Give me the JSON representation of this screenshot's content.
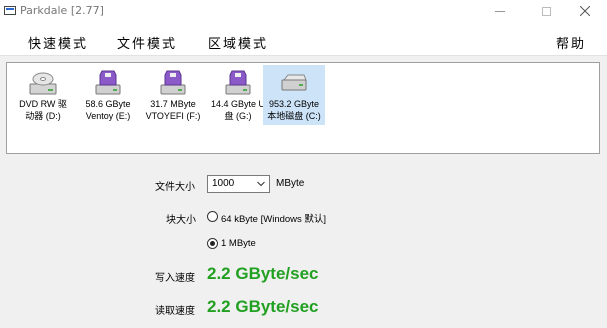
{
  "window": {
    "title": "Parkdale [2.77]",
    "controls": {
      "minimize": "minimize-icon",
      "maximize": "maximize-icon",
      "close": "close-icon"
    }
  },
  "menu": {
    "quick_mode": "快速模式",
    "file_mode": "文件模式",
    "block_mode": "区域模式",
    "help": "帮助"
  },
  "drives": [
    {
      "label": "DVD RW 驱\n动器 (D:)",
      "icon": "optical-drive-icon",
      "selected": false
    },
    {
      "label": "58.6 GByte\nVentoy (E:)",
      "icon": "usb-drive-icon",
      "selected": false
    },
    {
      "label": "31.7 MByte\nVTOYEFI (F:)",
      "icon": "usb-drive-icon",
      "selected": false
    },
    {
      "label": "14.4 GByte U\n盘 (G:)",
      "icon": "usb-drive-icon",
      "selected": false
    },
    {
      "label": "953.2 GByte\n本地磁盘 (C:)",
      "icon": "hard-drive-icon",
      "selected": true
    }
  ],
  "settings": {
    "file_size_label": "文件大小",
    "file_size_value": "1000",
    "file_size_unit": "MByte",
    "block_size_label": "块大小",
    "block_options": [
      {
        "label": "64 kByte [Windows 默认]",
        "checked": false
      },
      {
        "label": "1 MByte",
        "checked": true
      }
    ],
    "write_speed_label": "写入速度",
    "write_speed_value": "2.2 GByte/sec",
    "read_speed_label": "读取速度",
    "read_speed_value": "2.2 GByte/sec"
  },
  "colors": {
    "speed": "#22a022",
    "selected_drive": "#cde3f8"
  }
}
